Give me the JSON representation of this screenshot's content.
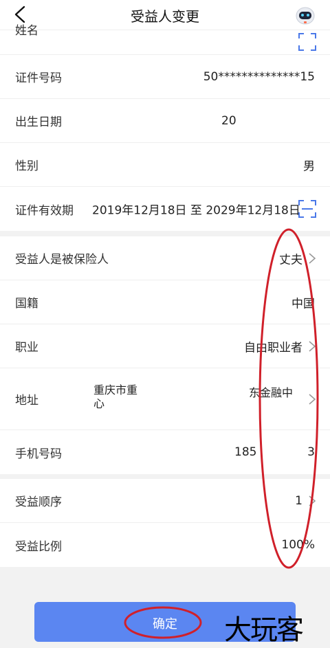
{
  "header": {
    "title": "受益人变更",
    "back_icon": "back-arrow-icon",
    "assistant_icon": "robot-assistant-icon"
  },
  "insured": {
    "name_label": "姓名",
    "id_number_label": "证件号码",
    "id_number_value": "50**************15",
    "dob_label": "出生日期",
    "dob_value": "20",
    "gender_label": "性别",
    "gender_value": "男",
    "id_validity_label": "证件有效期",
    "id_validity_value": "2019年12月18日 至 2029年12月18日"
  },
  "relation": {
    "relation_label": "受益人是被保险人",
    "relation_value": "丈夫",
    "nationality_label": "国籍",
    "nationality_value": "中国",
    "occupation_label": "职业",
    "occupation_value": "自由职业者",
    "address_label": "地址",
    "address_value_line1": "重庆市重",
    "address_value_line2": "心",
    "address_value_right": "东金融中",
    "phone_label": "手机号码",
    "phone_value_part1": "185",
    "phone_value_part2": "3"
  },
  "benefit": {
    "order_label": "受益顺序",
    "order_value": "1",
    "ratio_label": "受益比例",
    "ratio_value": "100%"
  },
  "footer": {
    "confirm_label": "确定",
    "watermark": "大玩客"
  },
  "colors": {
    "primary_button": "#5b86f1",
    "scan_icon": "#4a78e8",
    "annotation": "#d0202a"
  }
}
